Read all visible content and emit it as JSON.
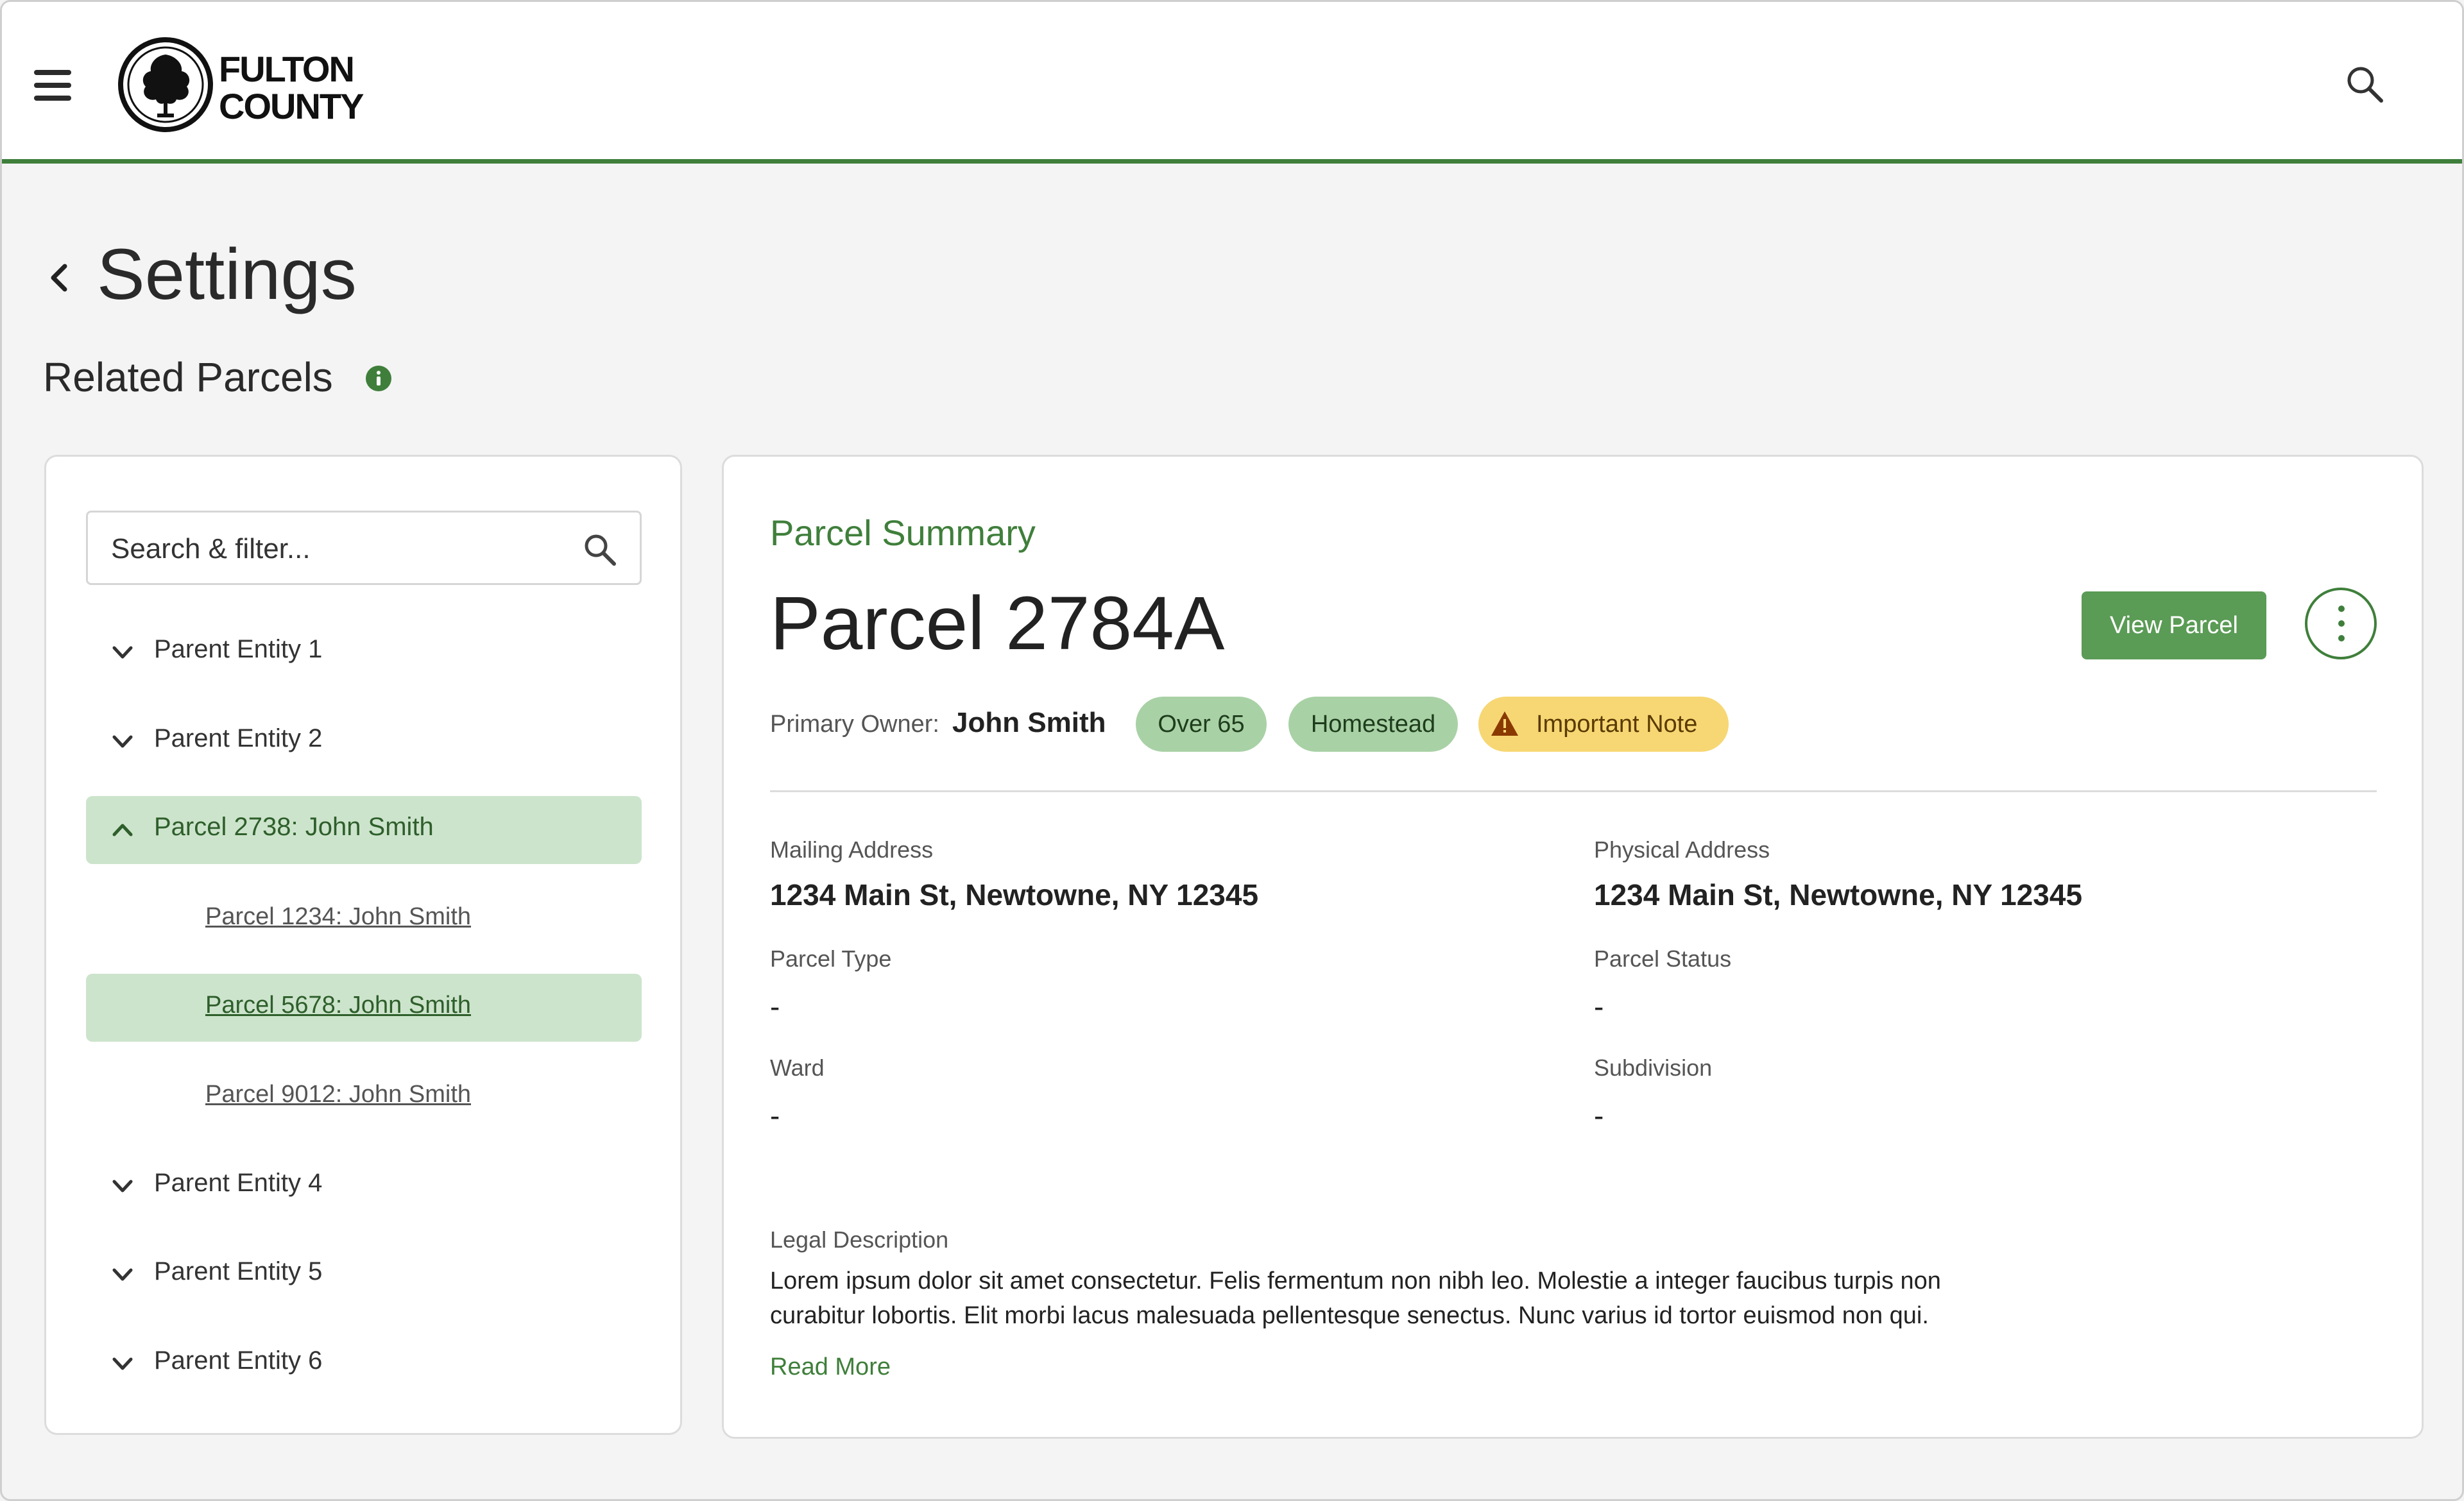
{
  "header": {
    "logo_line1": "FULTON",
    "logo_line2": "COUNTY",
    "menu_icon": "hamburger-icon",
    "search_icon": "search-icon"
  },
  "page": {
    "title": "Settings",
    "section_title": "Related Parcels"
  },
  "sidebar": {
    "search_placeholder": "Search & filter...",
    "items": [
      {
        "label": "Parent Entity 1",
        "state": "collapsed"
      },
      {
        "label": "Parent Entity 2",
        "state": "collapsed"
      },
      {
        "label": "Parcel 2738: John Smith",
        "state": "expanded",
        "selected": true
      },
      {
        "label": "Parcel 1234: John Smith",
        "child": true
      },
      {
        "label": "Parcel 5678: John Smith",
        "child": true,
        "selected": true
      },
      {
        "label": "Parcel 9012: John Smith",
        "child": true
      },
      {
        "label": "Parent Entity 4",
        "state": "collapsed"
      },
      {
        "label": "Parent Entity 5",
        "state": "collapsed"
      },
      {
        "label": "Parent Entity 6",
        "state": "collapsed"
      }
    ]
  },
  "summary": {
    "label": "Parcel Summary",
    "title": "Parcel 2784A",
    "view_button": "View Parcel",
    "owner_label": "Primary Owner:",
    "owner_value": "John Smith",
    "badges": [
      "Over 65",
      "Homestead",
      "Important Note"
    ],
    "fields": {
      "mailing_label": "Mailing Address",
      "mailing_value": "1234 Main St, Newtowne, NY 12345",
      "physical_label": "Physical Address",
      "physical_value": "1234 Main St, Newtowne, NY 12345",
      "type_label": "Parcel Type",
      "type_value": "-",
      "status_label": "Parcel Status",
      "status_value": "-",
      "ward_label": "Ward",
      "ward_value": "-",
      "subdivision_label": "Subdivision",
      "subdivision_value": "-"
    },
    "legal_label": "Legal Description",
    "legal_text": "Lorem ipsum dolor sit amet consectetur. Felis fermentum non nibh leo. Molestie a integer faucibus turpis non curabitur lobortis. Elit morbi lacus malesuada pellentesque senectus. Nunc varius id tortor euismod non qui.",
    "read_more": "Read More"
  },
  "colors": {
    "brand_green": "#3f7f3b",
    "selected_bg": "#cde4cc",
    "badge_green": "#a9d1a6",
    "badge_yellow": "#f7d774"
  }
}
